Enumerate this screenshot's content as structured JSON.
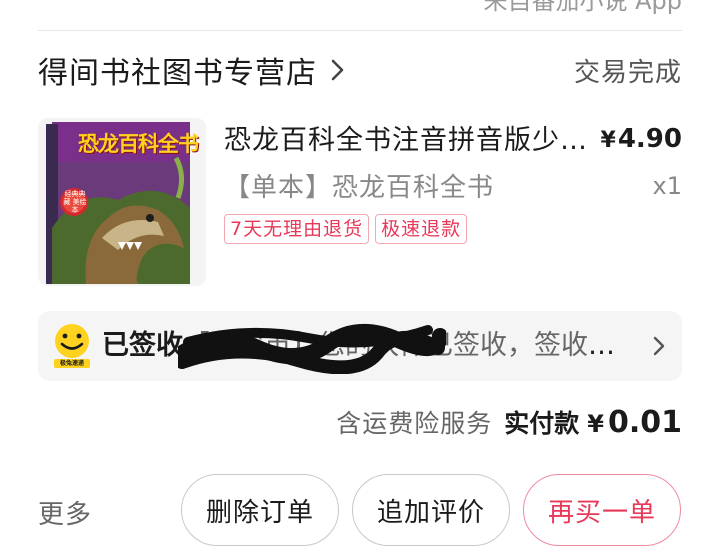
{
  "header": {
    "source_app": "来自番茄小说 App"
  },
  "shop": {
    "name": "得间书社图书专营店",
    "status": "交易完成"
  },
  "product": {
    "title": "恐龙百科全书注音拼音版少儿科普读物",
    "price_symbol": "¥",
    "price_value": "4.90",
    "spec": "【单本】恐龙百科全书",
    "quantity": "x1",
    "tags": [
      "7天无理由退货",
      "极速退款"
    ],
    "cover_text": "恐龙百科全书",
    "cover_badge": "经典典藏 美绘本"
  },
  "logistics": {
    "courier_logo_text": "极兔速递",
    "signed_label": "已签收",
    "detail_visible": "【吉安市】您的快件已签收，签收人在..."
  },
  "summary": {
    "insurance_label": "含运费险服务",
    "paid_label": "实付款",
    "paid_symbol": "¥",
    "paid_amount": "0.01"
  },
  "actions": {
    "more_label": "更多",
    "delete_label": "删除订单",
    "review_label": "追加评价",
    "rebuy_label": "再买一单"
  },
  "colors": {
    "accent": "#e8395a",
    "accent_border": "#f08a9f",
    "tag_border": "#f3a7b3",
    "logistics_bg": "#f5f5f5",
    "courier_yellow": "#ffd21f"
  }
}
